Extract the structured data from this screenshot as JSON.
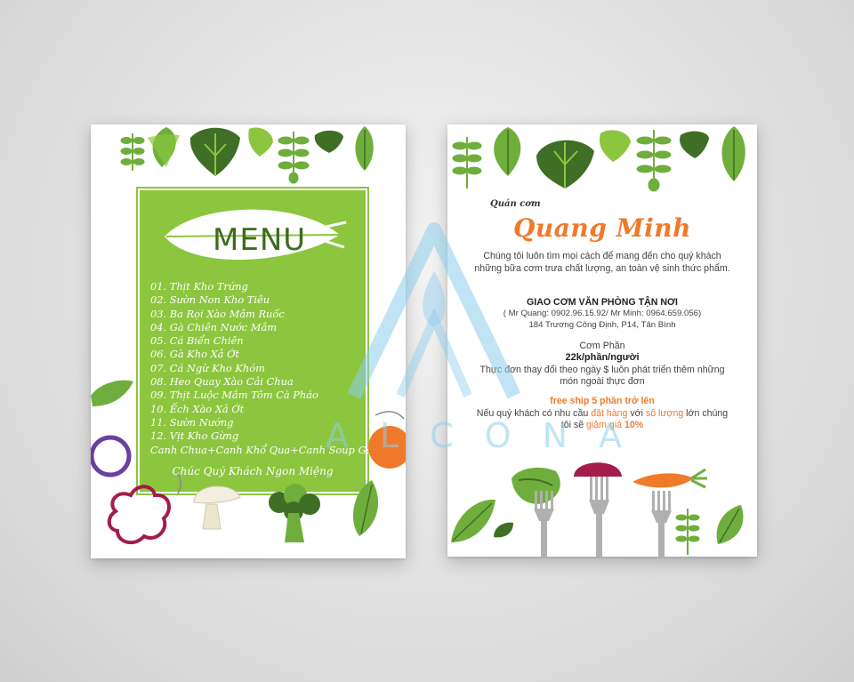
{
  "left_flyer": {
    "menu_title": "MENU",
    "menu_items": [
      "01. Thịt Kho Trứng",
      "02. Sườn Non Kho Tiêu",
      "03. Ba Rọi Xào Mắm Ruốc",
      "04. Gà Chiên Nước Mắm",
      "05. Cá Biển Chiên",
      "06. Gà Kho Xả Ớt",
      "07. Cá Ngừ Kho Khóm",
      "08. Heo Quay Xào Cải Chua",
      "09. Thịt Luộc Mắm Tôm Cà Pháo",
      "10. Ếch Xào Xả Ớt",
      "11. Sườn Nướng",
      "12. Vịt Kho Gừng",
      "Canh Chua+Canh Khổ Qua+Canh Soup Gà"
    ],
    "greeting": "Chúc Quý Khách Ngon Miệng"
  },
  "right_flyer": {
    "shop_label": "Quán cơm",
    "shop_name": "Quang Minh",
    "intro": "Chúng tôi luôn tìm mọi cách để mang đến cho quý khách những bữa cơm trưa chất lượng, an toàn vệ sinh thức phẩm.",
    "delivery_title": "GIAO CƠM VĂN PHÒNG TẬN NƠI",
    "contact_phones": "( Mr Quang: 0902.96.15.92/ Mr Minh: 0964.659.056)",
    "address": "184 Trương Công Định, P14, Tân Bình",
    "price_title": "Cơm Phần",
    "price": "22k/phần/người",
    "menu_note": "Thực đơn thay đổi theo ngày $ luôn phát triển thêm những món ngoài thực đơn",
    "free_ship": "free ship 5 phần trở lên",
    "offer_part1": "Nếu quý khách có nhu cầu ",
    "offer_highlight1": "đặt hàng",
    "offer_part2": " với ",
    "offer_highlight2": "số lượng",
    "offer_part3": " lớn chúng tôi sẽ ",
    "offer_highlight3": "giảm giá",
    "offer_discount": " 10%"
  },
  "watermark": {
    "text": "ALCONA"
  },
  "colors": {
    "menu_green": "#8cc63f",
    "leaf_green": "#6fae3c",
    "leaf_dark": "#3f6e25",
    "brand_orange": "#f07a2a",
    "beet": "#a31c4a",
    "onion": "#6b3fa0"
  },
  "icons": [
    "leaf-icon",
    "fern-icon",
    "onion-ring-icon",
    "carrot-slice-icon",
    "bell-pepper-icon",
    "mushroom-icon",
    "broccoli-icon",
    "fork-icon",
    "carrot-icon",
    "beet-icon",
    "lettuce-icon"
  ]
}
